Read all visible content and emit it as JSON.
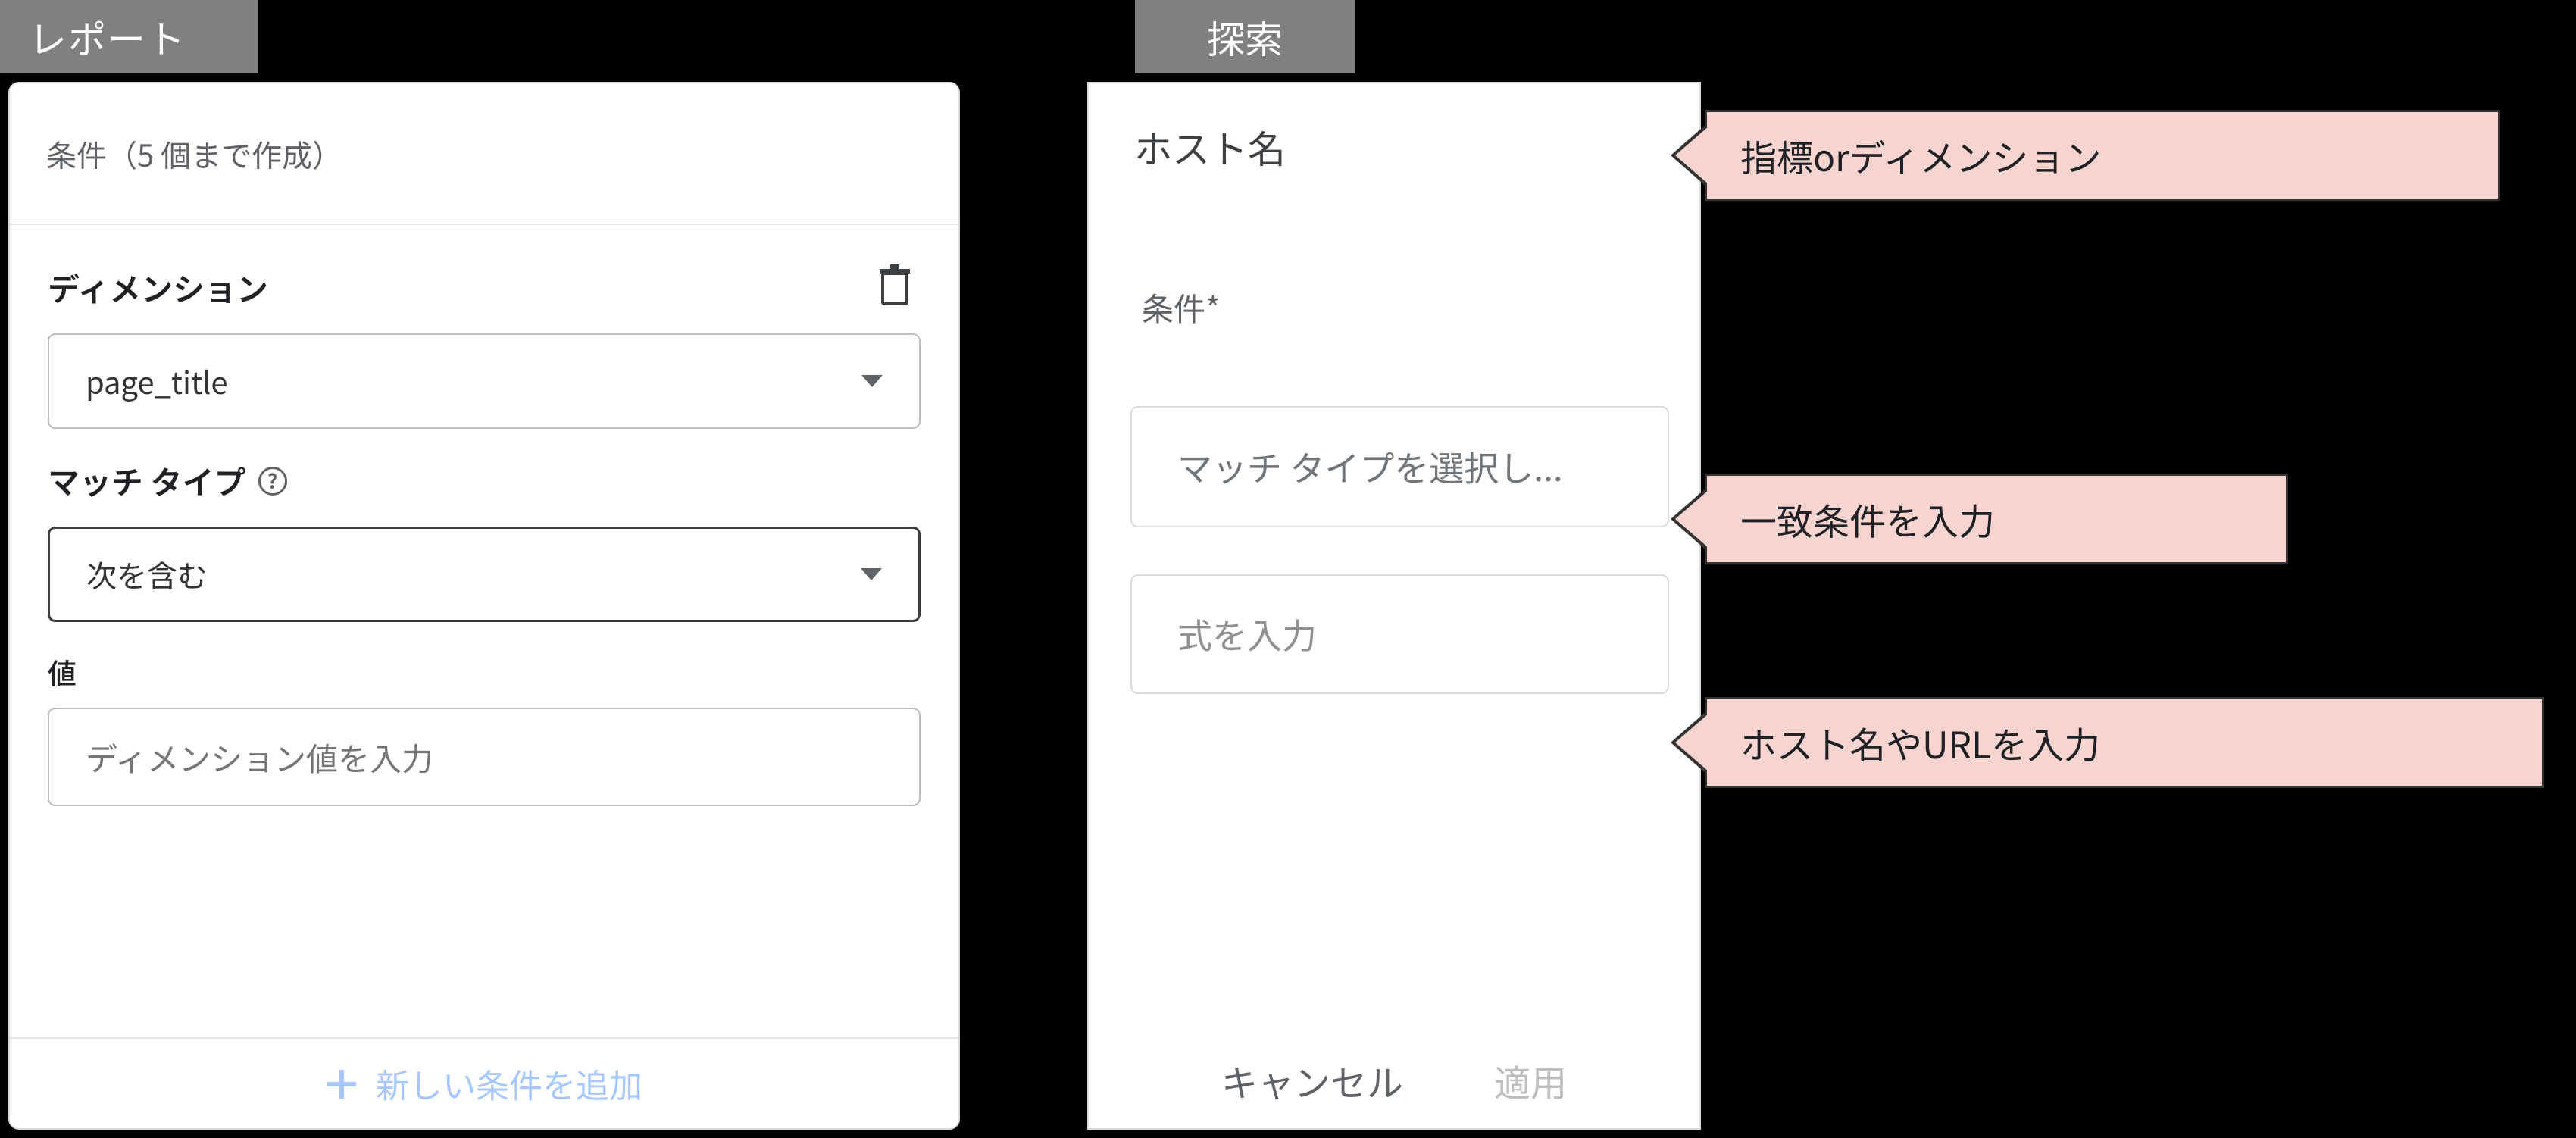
{
  "report": {
    "tab_label": "レポート",
    "conditions_header": "条件（5 個まで作成）",
    "dimension_label": "ディメンション",
    "dimension_value": "page_title",
    "match_type_label": "マッチ タイプ",
    "match_type_value": "次を含む",
    "value_label": "値",
    "value_placeholder": "ディメンション値を入力",
    "add_condition_label": "新しい条件を追加"
  },
  "explore": {
    "tab_label": "探索",
    "title": "ホスト名",
    "conditions_label": "条件*",
    "match_type_placeholder": "マッチ タイプを選択し...",
    "expression_placeholder": "式を入力",
    "cancel_label": "キャンセル",
    "apply_label": "適用"
  },
  "callouts": {
    "metric_or_dimension": "指標orディメンション",
    "enter_match_condition": "一致条件を入力",
    "enter_host_or_url": "ホスト名やURLを入力"
  }
}
